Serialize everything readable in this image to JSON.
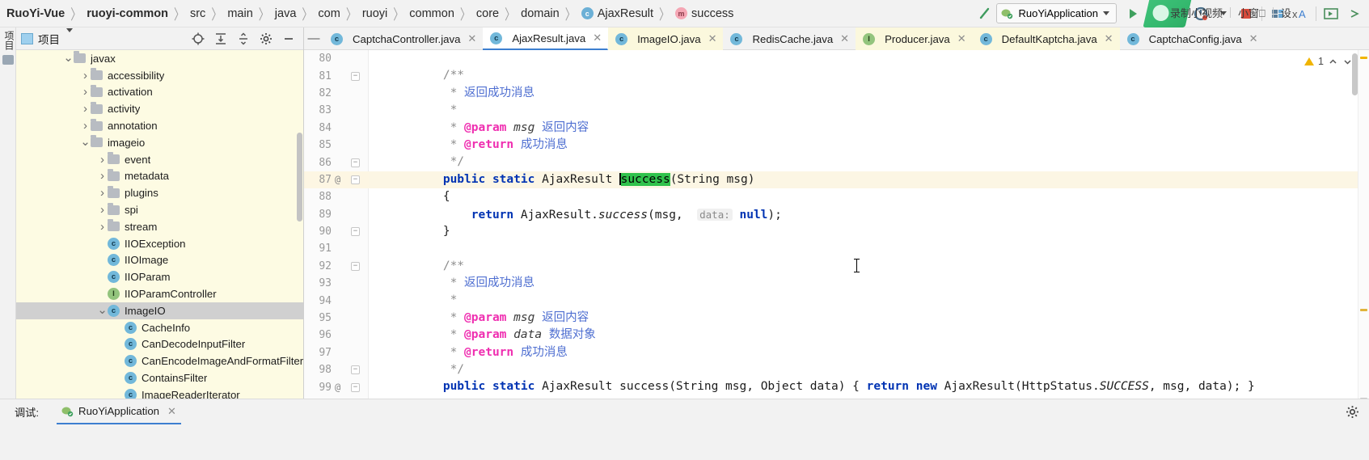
{
  "breadcrumb": {
    "items": [
      {
        "label": "RuoYi-Vue",
        "bold": true,
        "icon": null
      },
      {
        "label": "ruoyi-common",
        "bold": true,
        "icon": null
      },
      {
        "label": "src",
        "bold": false,
        "icon": null
      },
      {
        "label": "main",
        "bold": false,
        "icon": null
      },
      {
        "label": "java",
        "bold": false,
        "icon": null
      },
      {
        "label": "com",
        "bold": false,
        "icon": null
      },
      {
        "label": "ruoyi",
        "bold": false,
        "icon": null
      },
      {
        "label": "common",
        "bold": false,
        "icon": null
      },
      {
        "label": "core",
        "bold": false,
        "icon": null
      },
      {
        "label": "domain",
        "bold": false,
        "icon": null
      },
      {
        "label": "AjaxResult",
        "bold": false,
        "icon": "class-icon"
      },
      {
        "label": "success",
        "bold": false,
        "icon": "method-icon"
      }
    ],
    "separator": "〉"
  },
  "toolbar": {
    "run_config": "RuoYiApplication",
    "run_button": "run-icon",
    "debug_button": "debug-icon",
    "coverage_button": "coverage-icon",
    "profile_button": "profile-icon",
    "stop_button": "stop-icon",
    "layout_button": "layout-icon",
    "translate_button": "translate-icon",
    "present_button": "present-icon",
    "hammer_button": "build-icon"
  },
  "recorder_overlay": {
    "items": [
      "录制小视频",
      "小窗⎕",
      "设"
    ]
  },
  "tool_strip": {
    "label": "项目"
  },
  "project_panel": {
    "title": "项目",
    "actions": [
      "locate-icon",
      "expand-all-icon",
      "collapse-all-icon",
      "gear-icon",
      "minimize-icon"
    ],
    "tree": [
      {
        "depth": 2,
        "arrow": "expanded",
        "type": "folder",
        "label": "javax",
        "selected": false
      },
      {
        "depth": 3,
        "arrow": "collapsed",
        "type": "folder",
        "label": "accessibility",
        "selected": false
      },
      {
        "depth": 3,
        "arrow": "collapsed",
        "type": "folder",
        "label": "activation",
        "selected": false
      },
      {
        "depth": 3,
        "arrow": "collapsed",
        "type": "folder",
        "label": "activity",
        "selected": false
      },
      {
        "depth": 3,
        "arrow": "collapsed",
        "type": "folder",
        "label": "annotation",
        "selected": false
      },
      {
        "depth": 3,
        "arrow": "expanded",
        "type": "folder",
        "label": "imageio",
        "selected": false
      },
      {
        "depth": 4,
        "arrow": "collapsed",
        "type": "folder",
        "label": "event",
        "selected": false
      },
      {
        "depth": 4,
        "arrow": "collapsed",
        "type": "folder",
        "label": "metadata",
        "selected": false
      },
      {
        "depth": 4,
        "arrow": "collapsed",
        "type": "folder",
        "label": "plugins",
        "selected": false
      },
      {
        "depth": 4,
        "arrow": "collapsed",
        "type": "folder",
        "label": "spi",
        "selected": false
      },
      {
        "depth": 4,
        "arrow": "collapsed",
        "type": "folder",
        "label": "stream",
        "selected": false
      },
      {
        "depth": 4,
        "arrow": "none",
        "type": "class",
        "label": "IIOException",
        "selected": false
      },
      {
        "depth": 4,
        "arrow": "none",
        "type": "class",
        "label": "IIOImage",
        "selected": false
      },
      {
        "depth": 4,
        "arrow": "none",
        "type": "class",
        "label": "IIOParam",
        "selected": false
      },
      {
        "depth": 4,
        "arrow": "none",
        "type": "interface",
        "label": "IIOParamController",
        "selected": false
      },
      {
        "depth": 4,
        "arrow": "expanded",
        "type": "class",
        "label": "ImageIO",
        "selected": true
      },
      {
        "depth": 5,
        "arrow": "none",
        "type": "class",
        "label": "CacheInfo",
        "selected": false
      },
      {
        "depth": 5,
        "arrow": "none",
        "type": "class",
        "label": "CanDecodeInputFilter",
        "selected": false
      },
      {
        "depth": 5,
        "arrow": "none",
        "type": "class",
        "label": "CanEncodeImageAndFormatFilter",
        "selected": false
      },
      {
        "depth": 5,
        "arrow": "none",
        "type": "class",
        "label": "ContainsFilter",
        "selected": false
      },
      {
        "depth": 5,
        "arrow": "none",
        "type": "class",
        "label": "ImageReaderIterator",
        "selected": false
      }
    ]
  },
  "editor_tabs": [
    {
      "label": "CaptchaController.java",
      "icon": "class-icon",
      "state": "normal"
    },
    {
      "label": "AjaxResult.java",
      "icon": "class-icon",
      "state": "active"
    },
    {
      "label": "ImageIO.java",
      "icon": "class-icon",
      "state": "marked"
    },
    {
      "label": "RedisCache.java",
      "icon": "class-icon",
      "state": "normal"
    },
    {
      "label": "Producer.java",
      "icon": "interface-icon",
      "state": "marked"
    },
    {
      "label": "DefaultKaptcha.java",
      "icon": "class-icon",
      "state": "marked"
    },
    {
      "label": "CaptchaConfig.java",
      "icon": "class-icon",
      "state": "normal"
    }
  ],
  "editor": {
    "first_visible_line": 80,
    "inspection_warning_count": "1",
    "lines": [
      {
        "n": "80",
        "at": false,
        "fold": "",
        "hl": false,
        "tokens": []
      },
      {
        "n": "81",
        "at": false,
        "fold": "minus",
        "hl": false,
        "tokens": [
          {
            "t": "cm",
            "v": "        /**"
          }
        ]
      },
      {
        "n": "82",
        "at": false,
        "fold": "",
        "hl": false,
        "tokens": [
          {
            "t": "cm",
            "v": "         * "
          },
          {
            "t": "cmt",
            "v": "返回成功消息"
          }
        ]
      },
      {
        "n": "83",
        "at": false,
        "fold": "",
        "hl": false,
        "tokens": [
          {
            "t": "cm",
            "v": "         *"
          }
        ]
      },
      {
        "n": "84",
        "at": false,
        "fold": "",
        "hl": false,
        "tokens": [
          {
            "t": "cm",
            "v": "         * "
          },
          {
            "t": "tag",
            "v": "@param"
          },
          {
            "t": "cm",
            "v": " "
          },
          {
            "t": "par",
            "v": "msg"
          },
          {
            "t": "cm",
            "v": " "
          },
          {
            "t": "cmt",
            "v": "返回内容"
          }
        ]
      },
      {
        "n": "85",
        "at": false,
        "fold": "",
        "hl": false,
        "tokens": [
          {
            "t": "cm",
            "v": "         * "
          },
          {
            "t": "tag",
            "v": "@return"
          },
          {
            "t": "cm",
            "v": " "
          },
          {
            "t": "cmt",
            "v": "成功消息"
          }
        ]
      },
      {
        "n": "86",
        "at": false,
        "fold": "plus",
        "hl": false,
        "tokens": [
          {
            "t": "cm",
            "v": "         */"
          }
        ]
      },
      {
        "n": "87",
        "at": true,
        "fold": "minus",
        "hl": true,
        "tokens": [
          {
            "t": "kw",
            "v": "        public static "
          },
          {
            "t": "id",
            "v": "AjaxResult "
          },
          {
            "t": "sel-hl",
            "v": "success"
          },
          {
            "t": "id",
            "v": "(String msg)"
          }
        ]
      },
      {
        "n": "88",
        "at": false,
        "fold": "",
        "hl": false,
        "tokens": [
          {
            "t": "id",
            "v": "        {"
          }
        ]
      },
      {
        "n": "89",
        "at": false,
        "fold": "",
        "hl": false,
        "tokens": [
          {
            "t": "kw",
            "v": "            return "
          },
          {
            "t": "id",
            "v": "AjaxResult."
          },
          {
            "t": "fni",
            "v": "success"
          },
          {
            "t": "id",
            "v": "(msg,  "
          },
          {
            "t": "hint",
            "v": "data:"
          },
          {
            "t": "kw",
            "v": " null"
          },
          {
            "t": "id",
            "v": ");"
          }
        ]
      },
      {
        "n": "90",
        "at": false,
        "fold": "plus",
        "hl": false,
        "tokens": [
          {
            "t": "id",
            "v": "        }"
          }
        ]
      },
      {
        "n": "91",
        "at": false,
        "fold": "",
        "hl": false,
        "tokens": []
      },
      {
        "n": "92",
        "at": false,
        "fold": "minus",
        "hl": false,
        "tokens": [
          {
            "t": "cm",
            "v": "        /**"
          }
        ]
      },
      {
        "n": "93",
        "at": false,
        "fold": "",
        "hl": false,
        "tokens": [
          {
            "t": "cm",
            "v": "         * "
          },
          {
            "t": "cmt",
            "v": "返回成功消息"
          }
        ]
      },
      {
        "n": "94",
        "at": false,
        "fold": "",
        "hl": false,
        "tokens": [
          {
            "t": "cm",
            "v": "         *"
          }
        ]
      },
      {
        "n": "95",
        "at": false,
        "fold": "",
        "hl": false,
        "tokens": [
          {
            "t": "cm",
            "v": "         * "
          },
          {
            "t": "tag",
            "v": "@param"
          },
          {
            "t": "cm",
            "v": " "
          },
          {
            "t": "par",
            "v": "msg"
          },
          {
            "t": "cm",
            "v": " "
          },
          {
            "t": "cmt",
            "v": "返回内容"
          }
        ]
      },
      {
        "n": "96",
        "at": false,
        "fold": "",
        "hl": false,
        "tokens": [
          {
            "t": "cm",
            "v": "         * "
          },
          {
            "t": "tag",
            "v": "@param"
          },
          {
            "t": "cm",
            "v": " "
          },
          {
            "t": "par",
            "v": "data"
          },
          {
            "t": "cm",
            "v": " "
          },
          {
            "t": "cmt",
            "v": "数据对象"
          }
        ]
      },
      {
        "n": "97",
        "at": false,
        "fold": "",
        "hl": false,
        "tokens": [
          {
            "t": "cm",
            "v": "         * "
          },
          {
            "t": "tag",
            "v": "@return"
          },
          {
            "t": "cm",
            "v": " "
          },
          {
            "t": "cmt",
            "v": "成功消息"
          }
        ]
      },
      {
        "n": "98",
        "at": false,
        "fold": "plus",
        "hl": false,
        "tokens": [
          {
            "t": "cm",
            "v": "         */"
          }
        ]
      },
      {
        "n": "99",
        "at": true,
        "fold": "plus",
        "hl": false,
        "tokens": [
          {
            "t": "kw",
            "v": "        public static "
          },
          {
            "t": "id",
            "v": "AjaxResult "
          },
          {
            "t": "fn",
            "v": "success"
          },
          {
            "t": "id",
            "v": "(String msg, Object data) { "
          },
          {
            "t": "kw",
            "v": "return new "
          },
          {
            "t": "id",
            "v": "AjaxResult(HttpStatus."
          },
          {
            "t": "stat",
            "v": "SUCCESS"
          },
          {
            "t": "id",
            "v": ", msg, data); }"
          }
        ]
      }
    ]
  },
  "statusbar": {
    "label": "调试:",
    "debug_tab": "RuoYiApplication",
    "settings_icon": "gear-icon"
  },
  "colors": {
    "accent_blue": "#3d7fd0",
    "tree_bg": "#fdfbe3",
    "selection_green": "#31c24c",
    "warning_yellow": "#f0b400",
    "keyword_blue": "#0033b3",
    "javadoc_tag_pink": "#ef2eb0",
    "javadoc_text_blue": "#4f6fd1"
  }
}
